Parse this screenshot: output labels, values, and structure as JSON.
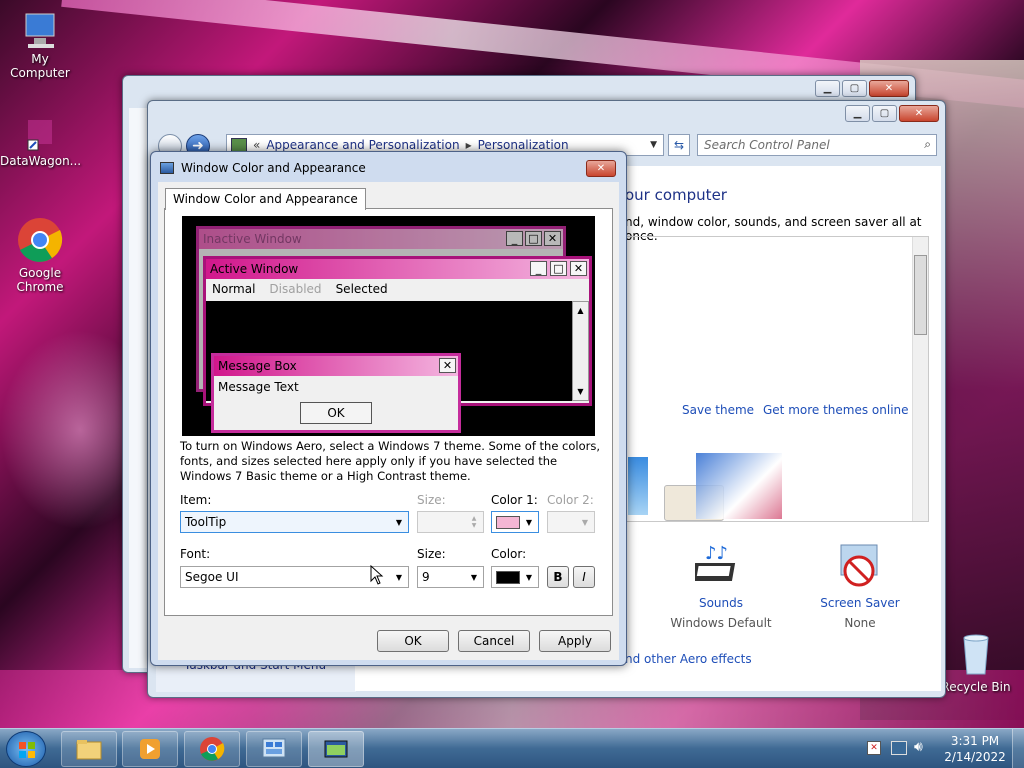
{
  "desktop": {
    "icons": [
      {
        "label": "My Computer"
      },
      {
        "label": "DataWagon..."
      },
      {
        "label": "Google Chrome"
      },
      {
        "label": "Recycle Bin"
      }
    ]
  },
  "control_panel": {
    "breadcrumb": [
      "Appearance and Personalization",
      "Personalization"
    ],
    "search_placeholder": "Search Control Panel",
    "heading": "our computer",
    "description": "nd, window color, sounds, and screen saver all at once.",
    "save_theme": "Save theme",
    "get_more_themes": "Get more themes online",
    "sounds_label": "Sounds",
    "sounds_value": "Windows Default",
    "screensaver_label": "Screen Saver",
    "screensaver_value": "None",
    "aero_link": "nd other Aero effects",
    "taskbar_link": "Taskbar and Start Menu"
  },
  "dialog": {
    "title": "Window Color and Appearance",
    "tab_label": "Window Color and Appearance",
    "preview": {
      "inactive_title": "Inactive Window",
      "active_title": "Active Window",
      "menu": [
        "Normal",
        "Disabled",
        "Selected"
      ],
      "msgbox_title": "Message Box",
      "msgbox_text": "Message Text",
      "ok": "OK"
    },
    "help_text": "To turn on Windows Aero, select a Windows 7 theme.  Some of the colors, fonts, and sizes selected here apply only if you have selected the Windows 7 Basic theme or a High Contrast theme.",
    "item_label": "Item:",
    "item_value": "ToolTip",
    "size_label_disabled": "Size:",
    "color1_label": "Color 1:",
    "color1_value": "#f4b6d4",
    "color2_label": "Color 2:",
    "font_label": "Font:",
    "font_value": "Segoe UI",
    "font_size_label": "Size:",
    "font_size_value": "9",
    "font_color_label": "Color:",
    "font_color_value": "#000000",
    "bold_label": "B",
    "italic_label": "I",
    "ok_label": "OK",
    "cancel_label": "Cancel",
    "apply_label": "Apply"
  },
  "taskbar": {
    "time": "3:31 PM",
    "date": "2/14/2022"
  },
  "colors": {
    "accent_pink": "#d1178c",
    "title_blue": "#1e3287",
    "link_blue": "#1e4eb8"
  }
}
